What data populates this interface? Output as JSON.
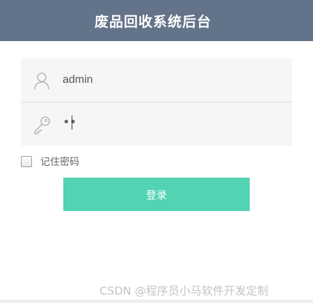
{
  "header": {
    "title": "废品回收系统后台",
    "background_color": "#63738a"
  },
  "login_form": {
    "username_value": "admin",
    "username_icon": "user-icon",
    "password_masked": "••",
    "password_icon": "key-icon",
    "remember_label": "记住密码",
    "remember_checked": false,
    "submit_label": "登录",
    "submit_color": "#52d3b4"
  },
  "watermark": "CSDN @程序员小马软件开发定制"
}
